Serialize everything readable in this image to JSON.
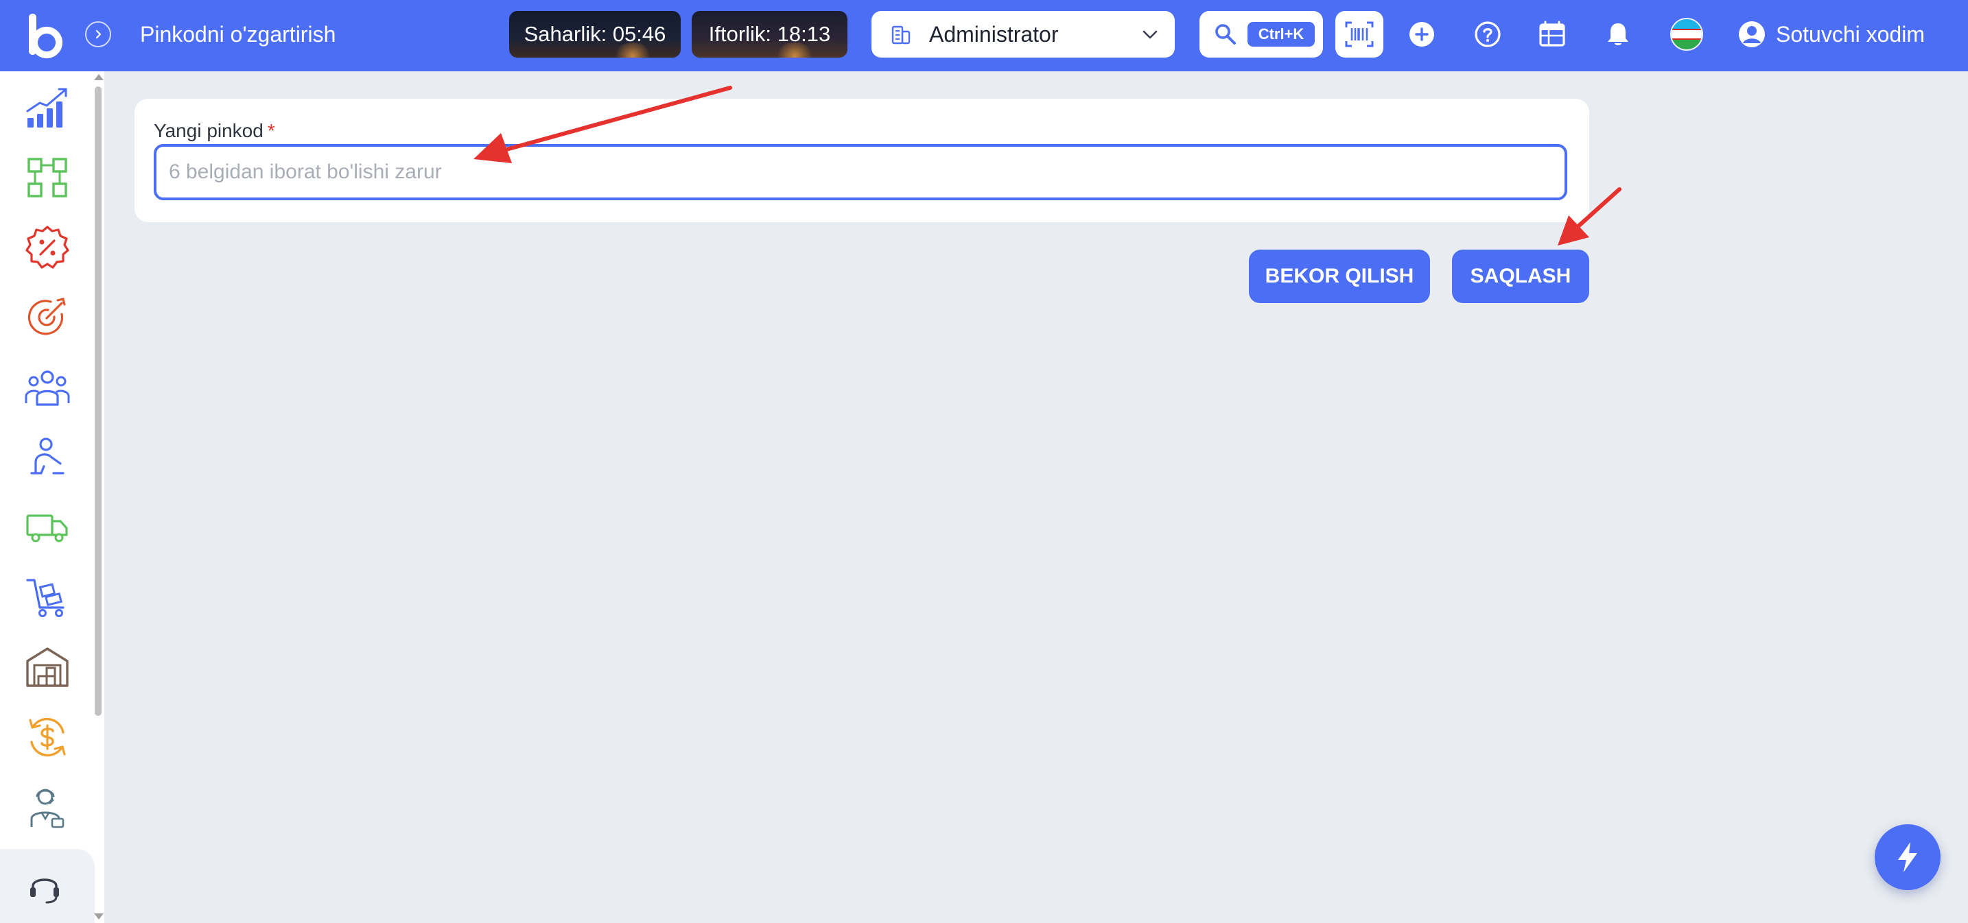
{
  "header": {
    "page_title": "Pinkodni o'zgartirish",
    "suhur": "Saharlik: 05:46",
    "iftar": "Iftorlik: 18:13",
    "role": "Administrator",
    "search_shortcut": "Ctrl+K",
    "user_name": "Sotuvchi xodim",
    "icons": [
      "logo-b",
      "chevron-right-icon",
      "building-icon",
      "chevron-down-icon",
      "search-icon",
      "barcode-icon",
      "plus-circle-icon",
      "help-circle-icon",
      "calendar-table-icon",
      "bell-icon",
      "uzbekistan-flag-icon",
      "user-circle-icon"
    ]
  },
  "sidebar": {
    "items": [
      {
        "name": "analytics-icon",
        "color": "#4c6ef5"
      },
      {
        "name": "dashboard-grid-icon",
        "color": "#5cc35a"
      },
      {
        "name": "discount-badge-icon",
        "color": "#e0362c"
      },
      {
        "name": "target-icon",
        "color": "#e0542c"
      },
      {
        "name": "customers-icon",
        "color": "#4c6ef5"
      },
      {
        "name": "employee-icon",
        "color": "#4c6ef5"
      },
      {
        "name": "delivery-truck-icon",
        "color": "#5cc35a"
      },
      {
        "name": "trolley-icon",
        "color": "#4c6ef5"
      },
      {
        "name": "warehouse-icon",
        "color": "#7a6455"
      },
      {
        "name": "currency-exchange-icon",
        "color": "#f0a02c"
      },
      {
        "name": "operator-icon",
        "color": "#5a7a8a"
      }
    ],
    "support_icon": "headset-icon"
  },
  "form": {
    "label": "Yangi pinkod",
    "required_mark": "*",
    "input_value": "",
    "input_placeholder": "6 belgidan iborat bo'lishi zarur"
  },
  "actions": {
    "cancel_label": "BEKOR QILISH",
    "save_label": "SAQLASH"
  },
  "fab_icon": "lightning-icon",
  "colors": {
    "primary": "#4c6ef5",
    "background": "#e9ecf0",
    "annotation_arrow": "#e5322e",
    "required": "#e5322e"
  }
}
